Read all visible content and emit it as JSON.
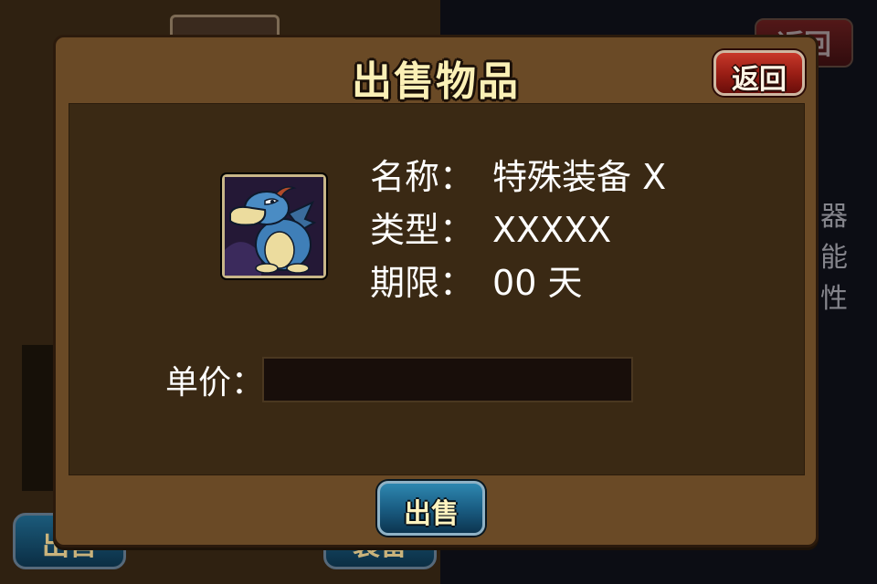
{
  "background": {
    "return_label": "返回",
    "side_text": [
      "器",
      "能",
      "性"
    ],
    "button_left_label": "出售",
    "button_right_label": "装备"
  },
  "modal": {
    "title": "出售物品",
    "return_label": "返回",
    "item": {
      "icon": "blue-dragon-icon",
      "name_label": "名称：",
      "name_value": "特殊装备 X",
      "type_label": "类型：",
      "type_value": "XXXXX",
      "duration_label": "期限：",
      "duration_value": "00 天"
    },
    "price_label": "单价：",
    "price_value": "",
    "sell_label": "出售"
  },
  "colors": {
    "panel": "#6a4a26",
    "content": "#3a2914",
    "title": "#fbf0b6",
    "return_button": "#a3241a",
    "sell_button": "#1a5e84"
  }
}
